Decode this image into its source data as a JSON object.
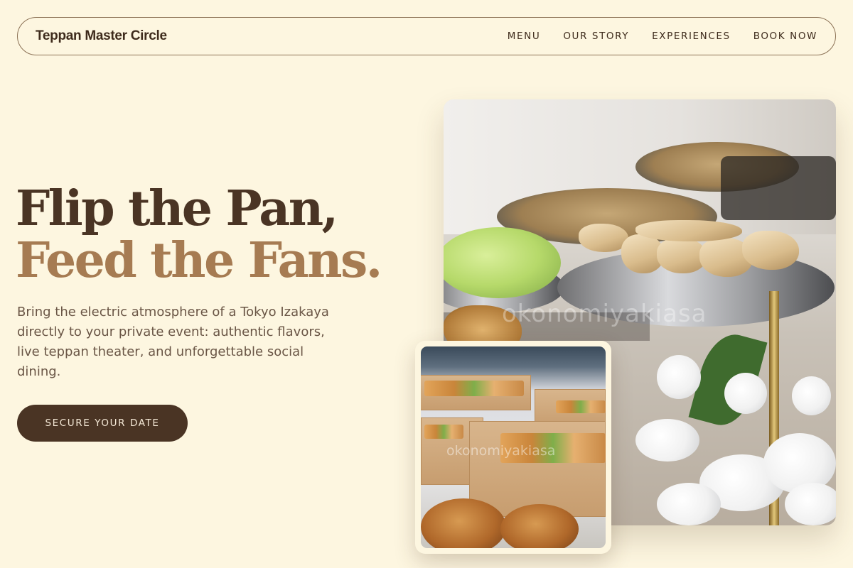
{
  "nav": {
    "brand": "Teppan Master Circle",
    "links": [
      "MENU",
      "OUR STORY",
      "EXPERIENCES",
      "BOOK NOW"
    ]
  },
  "hero": {
    "title_line1": "Flip the Pan,",
    "title_line2": "Feed the Fans.",
    "lead": "Bring the electric atmosphere of a Tokyo Izakaya directly to your private event: authentic flavors, live teppan theater, and unforgettable social dining.",
    "cta": "SECURE YOUR DATE"
  },
  "images": {
    "main_watermark": "okonomiyakiasa",
    "inset_watermark": "okonomiyakiasa"
  },
  "colors": {
    "background": "#fdf6e0",
    "primary_dark": "#4a3424",
    "accent": "#a67b52",
    "body_text": "#6a5646"
  }
}
